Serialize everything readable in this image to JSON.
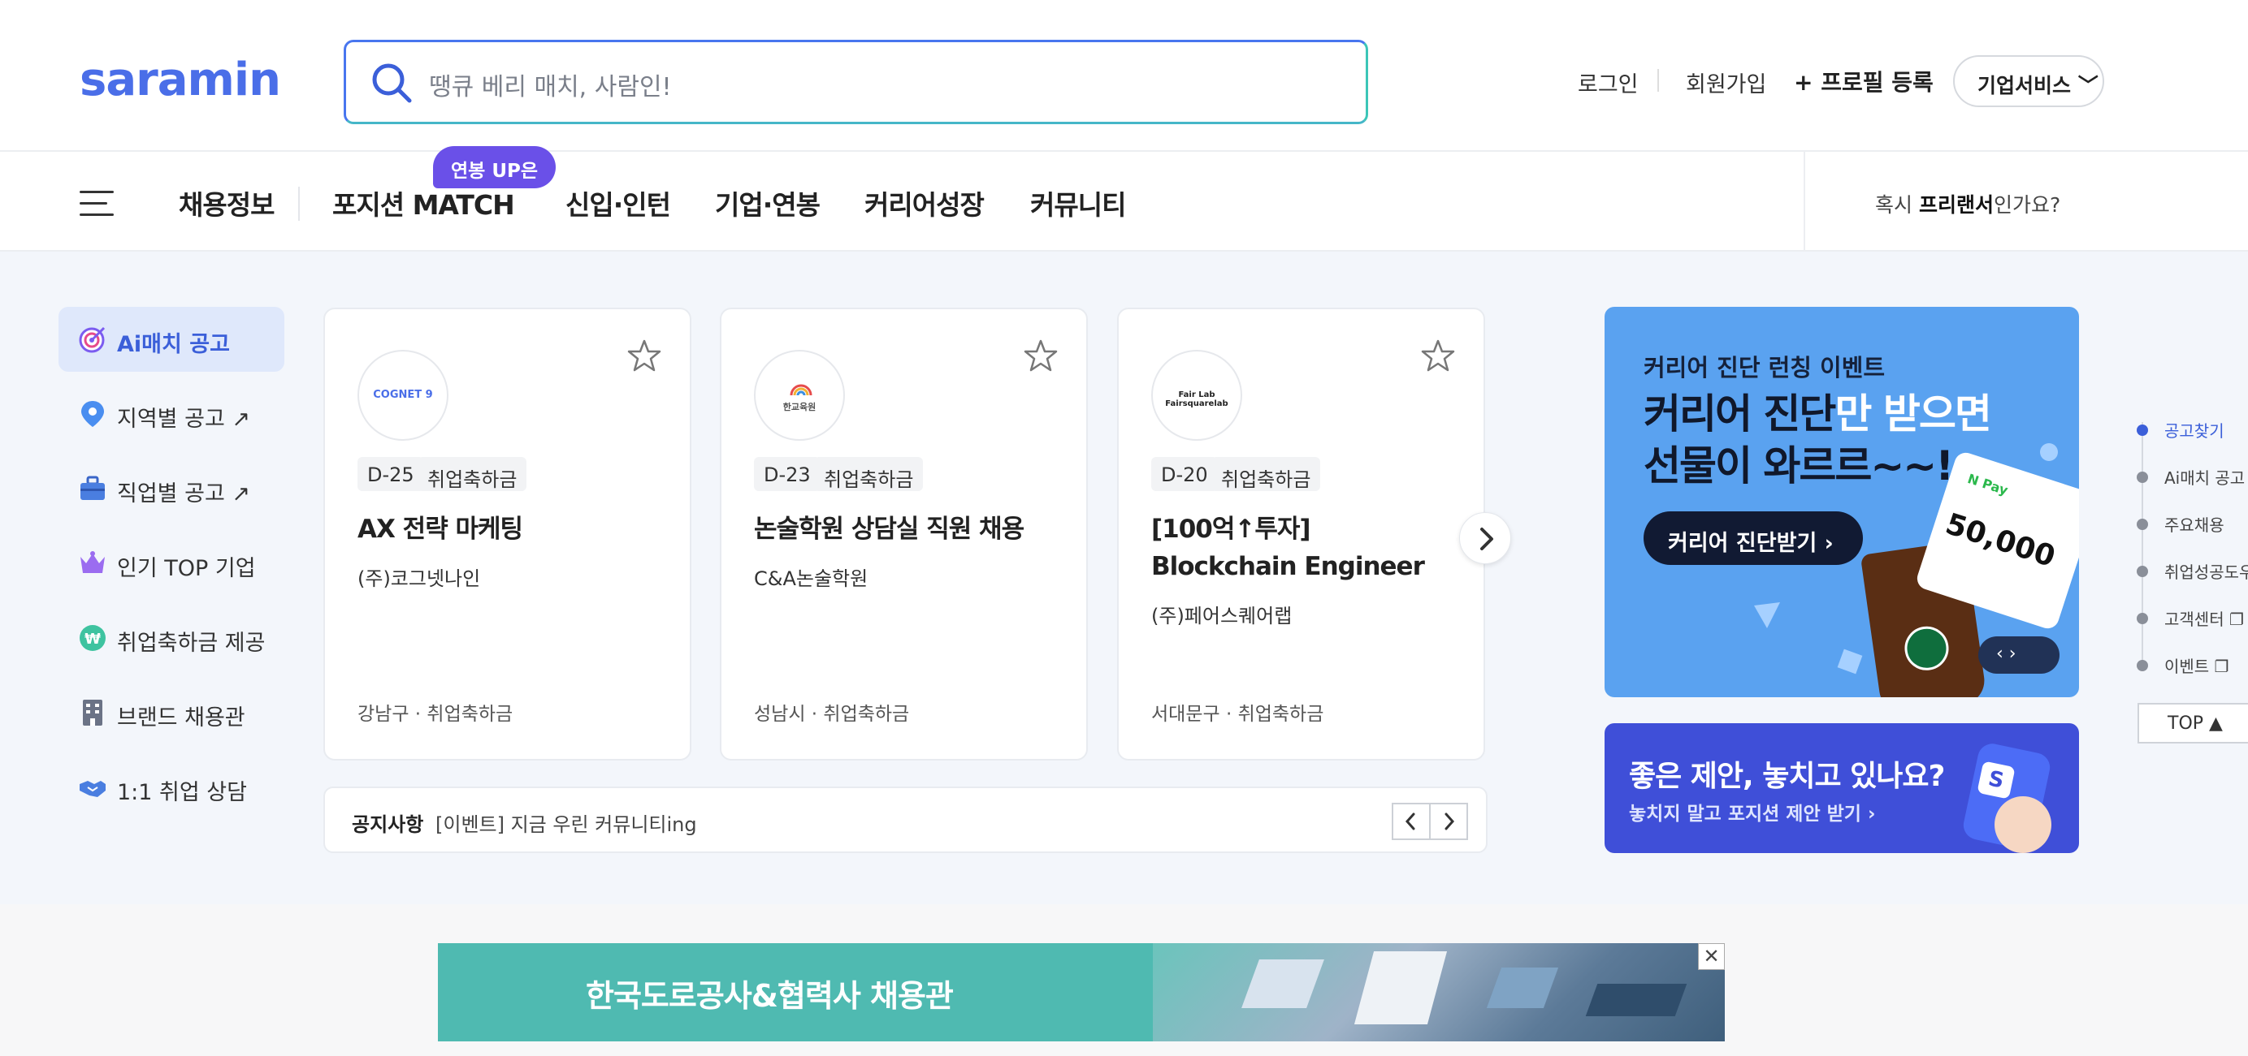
{
  "header": {
    "logo": "saramin",
    "search_placeholder": "땡큐 베리 매치, 사람인!",
    "login": "로그인",
    "signup": "회원가입",
    "profile_register": "+ 프로필 등록",
    "business_service": "기업서비스 ﹀"
  },
  "nav": {
    "items": [
      "채용정보",
      "포지션 MATCH",
      "신입·인턴",
      "기업·연봉",
      "커리어성장",
      "커뮤니티"
    ],
    "badge": "연봉 UP은",
    "freelance_prefix": "혹시 ",
    "freelance_bold": "프리랜서",
    "freelance_suffix": "인가요?"
  },
  "sidebar": {
    "items": [
      {
        "label": "Ai매치 공고",
        "icon": "target-icon"
      },
      {
        "label": "지역별 공고 ↗",
        "icon": "location-pin-icon"
      },
      {
        "label": "직업별 공고 ↗",
        "icon": "briefcase-icon"
      },
      {
        "label": "인기 TOP 기업",
        "icon": "crown-icon"
      },
      {
        "label": "취업축하금 제공",
        "icon": "won-coin-icon"
      },
      {
        "label": "브랜드 채용관",
        "icon": "building-icon"
      },
      {
        "label": "1:1 취업 상담",
        "icon": "handshake-icon"
      }
    ]
  },
  "jobs": [
    {
      "logo": "COGNET 9",
      "dday": "D-25",
      "tag": "취업축하금",
      "title": "AX 전략 마케팅",
      "company": "(주)코그넷나인",
      "location": "강남구 · 취업축하금"
    },
    {
      "logo": "한교육원",
      "dday": "D-23",
      "tag": "취업축하금",
      "title": "논술학원 상담실 직원 채용",
      "company": "C&A논술학원",
      "location": "성남시 · 취업축하금"
    },
    {
      "logo": "Fair Lab Fairsquarelab",
      "dday": "D-20",
      "tag": "취업축하금",
      "title": "[100억↑투자] Blockchain Engineer",
      "company": "(주)페어스퀘어랩",
      "location": "서대문구 · 취업축하금"
    }
  ],
  "notice": {
    "label": "공지사항",
    "text": "[이벤트] 지금 우린 커뮤니티ing"
  },
  "banner1": {
    "sub": "커리어 진단 런칭 이벤트",
    "line1_dark": "커리어 진단",
    "line1_white": "만 받으면",
    "line2": "선물이 와르르~~!",
    "cta": "커리어 진단받기 ›",
    "pay_label": "N Pay",
    "pay_amount": "50,000",
    "ctrl": "‹   ›"
  },
  "banner2": {
    "headline": "좋은 제안, 놓치고 있나요?",
    "sub": "놓치지 말고 포지션 제안 받기 ›"
  },
  "quicknav": {
    "items": [
      "공고찾기",
      "Ai매치 공고",
      "주요채용",
      "취업성공도우",
      "고객센터 ❐",
      "이벤트 ❐"
    ],
    "top": "TOP ▲"
  },
  "ad": {
    "text": "한국도로공사&협력사 채용관",
    "close": "✕"
  },
  "colors": {
    "brand": "#4a6ee8",
    "accent_purple": "#6a50e8",
    "main_bg": "#f3f6fb"
  }
}
